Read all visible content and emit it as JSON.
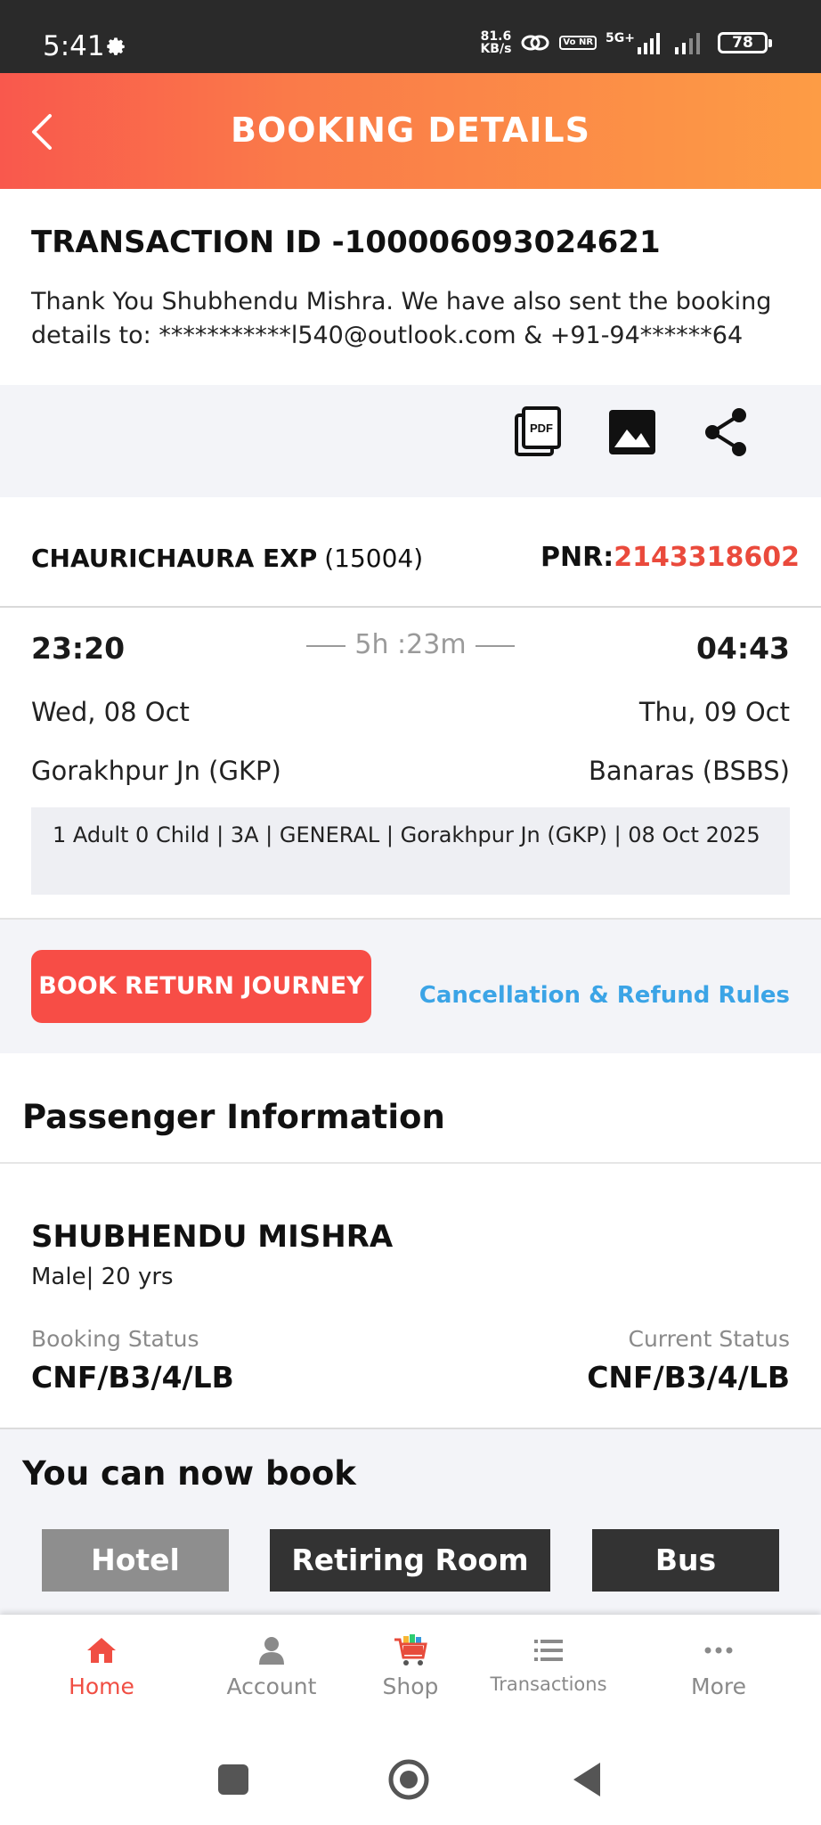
{
  "status_bar": {
    "time": "5:41",
    "net_speed_value": "81.6",
    "net_speed_unit": "KB/s",
    "volte": "Vo\nNR",
    "network": "5G+",
    "battery": "78"
  },
  "header": {
    "title": "BOOKING DETAILS"
  },
  "transaction": {
    "id_label": "TRANSACTION ID -100006093024621",
    "message": "Thank You Shubhendu Mishra. We have also sent the booking details to: ***********l540@outlook.com & +91-94******64"
  },
  "actions": {
    "icons": [
      "pdf-icon",
      "image-icon",
      "share-icon"
    ]
  },
  "train": {
    "name": "CHAURICHAURA EXP",
    "number": "(15004)",
    "pnr_label": "PNR:",
    "pnr_value": "2143318602",
    "departure_time": "23:20",
    "arrival_time": "04:43",
    "duration": "5h :23m",
    "departure_date": "Wed, 08 Oct",
    "arrival_date": "Thu, 09 Oct",
    "from_station": "Gorakhpur Jn (GKP)",
    "to_station": "Banaras (BSBS)",
    "journey_summary": "1 Adult 0 Child  | 3A | GENERAL | Gorakhpur Jn (GKP) | 08 Oct 2025"
  },
  "return_section": {
    "book_return_label": "BOOK RETURN JOURNEY",
    "cancellation_link": "Cancellation & Refund Rules"
  },
  "passenger_section": {
    "title": "Passenger Information",
    "passenger": {
      "name": "SHUBHENDU MISHRA",
      "meta": "Male| 20 yrs",
      "booking_status_label": "Booking Status",
      "booking_status": "CNF/B3/4/LB",
      "current_status_label": "Current Status",
      "current_status": "CNF/B3/4/LB"
    }
  },
  "book_now": {
    "title": "You can now book",
    "options": [
      "Hotel",
      "Retiring Room",
      "Bus"
    ]
  },
  "bottom_nav": {
    "items": [
      {
        "label": "Home",
        "icon": "home-icon",
        "active": true
      },
      {
        "label": "Account",
        "icon": "account-icon",
        "active": false
      },
      {
        "label": "Shop",
        "icon": "shop-cart-icon",
        "active": false
      },
      {
        "label": "Transactions",
        "icon": "transactions-icon",
        "active": false
      },
      {
        "label": "More",
        "icon": "more-icon",
        "active": false
      }
    ]
  },
  "colors": {
    "header_gradient_start": "#f9584d",
    "header_gradient_end": "#fd9c45",
    "pnr": "#ea4a3c",
    "primary_button": "#f74d46",
    "link": "#3ba4e6",
    "active_nav": "#f04e43"
  }
}
